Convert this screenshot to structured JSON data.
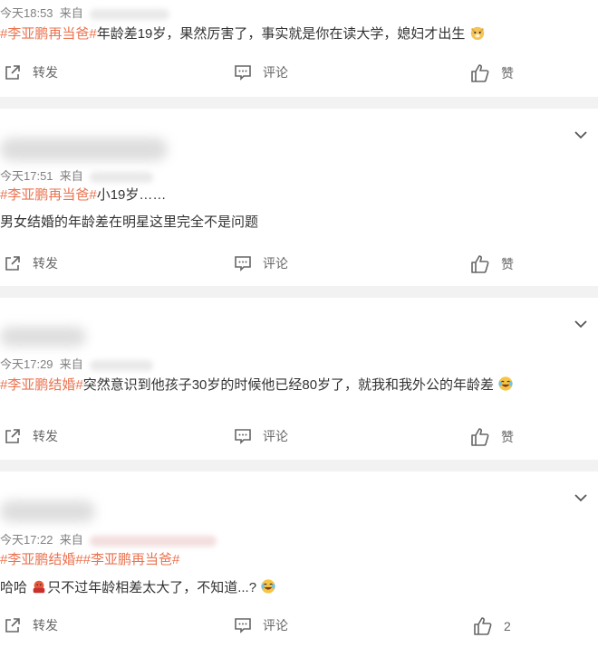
{
  "posts": [
    {
      "time": "今天18:53",
      "source_prefix": "来自",
      "lines": [
        {
          "tag": "#李亚鹏再当爸#",
          "text": "年龄差19岁，果然厉害了，事实就是你在读大学，媳妇才出生",
          "emoji": "doge-icon"
        }
      ],
      "actions": {
        "repost": "转发",
        "comment": "评论",
        "like": "赞"
      }
    },
    {
      "time": "今天17:51",
      "source_prefix": "来自",
      "lines": [
        {
          "tag": "#李亚鹏再当爸#",
          "text": "小19岁……"
        },
        {
          "tag": "",
          "text": "男女结婚的年龄差在明星这里完全不是问题"
        }
      ],
      "actions": {
        "repost": "转发",
        "comment": "评论",
        "like": "赞"
      }
    },
    {
      "time": "今天17:29",
      "source_prefix": "来自",
      "lines": [
        {
          "tag": "#李亚鹏结婚#",
          "text": "突然意识到他孩子30岁的时候他已经80岁了，就我和我外公的年龄差",
          "emoji": "laugh-cry-icon"
        }
      ],
      "actions": {
        "repost": "转发",
        "comment": "评论",
        "like": "赞"
      }
    },
    {
      "time": "今天17:22",
      "source_prefix": "来自",
      "lines": [
        {
          "tag": "#李亚鹏结婚##李亚鹏再当爸#",
          "text": ""
        },
        {
          "tag": "",
          "prefix": "哈哈",
          "text": "只不过年龄相差太大了，不知道...?"
        }
      ],
      "actions": {
        "repost": "转发",
        "comment": "评论",
        "like": "2"
      }
    }
  ]
}
